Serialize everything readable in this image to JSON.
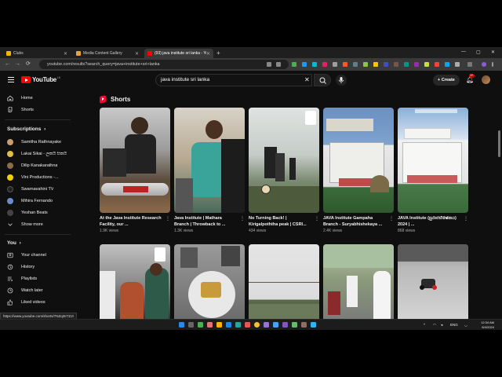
{
  "browser": {
    "tabs": [
      {
        "title": "Clubs",
        "color": "#f4b400",
        "active": false
      },
      {
        "title": "Media Content Gallery",
        "color": "#e6a23c",
        "active": false
      },
      {
        "title": "(93) java institute sri lanka - Yo",
        "color": "#ff0000",
        "active": true
      }
    ],
    "new_tab": "+",
    "url": "youtube.com/results?search_query=java+institute+sri+lanka",
    "window_controls": {
      "minimize": "—",
      "maximize": "▢",
      "close": "✕"
    },
    "nav": {
      "back": "←",
      "forward": "→",
      "reload": "⟳"
    }
  },
  "header": {
    "logo_text": "YouTube",
    "logo_country": "LK",
    "search_value": "java institute sri lanka",
    "search_clear": "✕",
    "create_label": "Create",
    "notification_count": "9+"
  },
  "sidebar": {
    "main_items": [
      {
        "label": "Home",
        "icon": "home-icon"
      },
      {
        "label": "Shorts",
        "icon": "shorts-icon"
      }
    ],
    "subscriptions_heading": "Subscriptions",
    "subscriptions_chevron": "›",
    "subscriptions": [
      {
        "label": "Samitha Rathnayake",
        "color": "#c9a06a"
      },
      {
        "label": "Lakai Sikai - ලකයි සිකයි",
        "color": "#e0c040"
      },
      {
        "label": "Dilip Kanakarathna",
        "color": "#8a6e4a"
      },
      {
        "label": "Vini Productions -...",
        "color": "#f0d000"
      },
      {
        "label": "Swarnavahini TV",
        "color": "#222222"
      },
      {
        "label": "Mihira Fernando",
        "color": "#6e8bd0"
      },
      {
        "label": "Yeshan Beats",
        "color": "#444444"
      }
    ],
    "show_more": "Show more",
    "you_heading": "You",
    "you_chevron": "›",
    "you_items": [
      {
        "label": "Your channel",
        "icon": "channel-icon"
      },
      {
        "label": "History",
        "icon": "history-icon"
      },
      {
        "label": "Playlists",
        "icon": "playlists-icon"
      },
      {
        "label": "Watch later",
        "icon": "clock-icon"
      },
      {
        "label": "Liked videos",
        "icon": "like-icon"
      }
    ]
  },
  "main": {
    "shorts_heading": "Shorts",
    "row1": [
      {
        "title": "At the Java Institute Research Facility, our ...",
        "views": "1.9K views"
      },
      {
        "title": "Java Institute | Mathara Branch | Throwback to ...",
        "views": "1.3K views"
      },
      {
        "title": "No Turning Back! | Kirigalpoththa peak | CSRI...",
        "views": "434 views"
      },
      {
        "title": "JAVA Institute Gampaha Branch - Suryabhishekaya ...",
        "views": "2.4K views"
      },
      {
        "title": "JAVA Institute (සුරාජභිෂේකය) 2024 | ...",
        "views": "868 views"
      }
    ],
    "row2": [
      {
        "title": "",
        "views": ""
      },
      {
        "title": "",
        "views": ""
      },
      {
        "title": "",
        "views": ""
      },
      {
        "title": "",
        "views": ""
      },
      {
        "title": "",
        "views": ""
      }
    ],
    "thumb_badges": [
      "JAVA INSTITUTE"
    ],
    "menu_glyph": "⋮"
  },
  "status_bar_url": "https://www.youtube.com/shorts/7NZq2Ir7ZJI",
  "taskbar": {
    "tray_lang": "ENG",
    "time": "12:34 AM",
    "date": "8/4/2024",
    "tray_chevron": "^"
  },
  "colors": {
    "bg": "#0f0f0f",
    "brand_red": "#ff0000",
    "text_secondary": "#aaaaaa"
  }
}
